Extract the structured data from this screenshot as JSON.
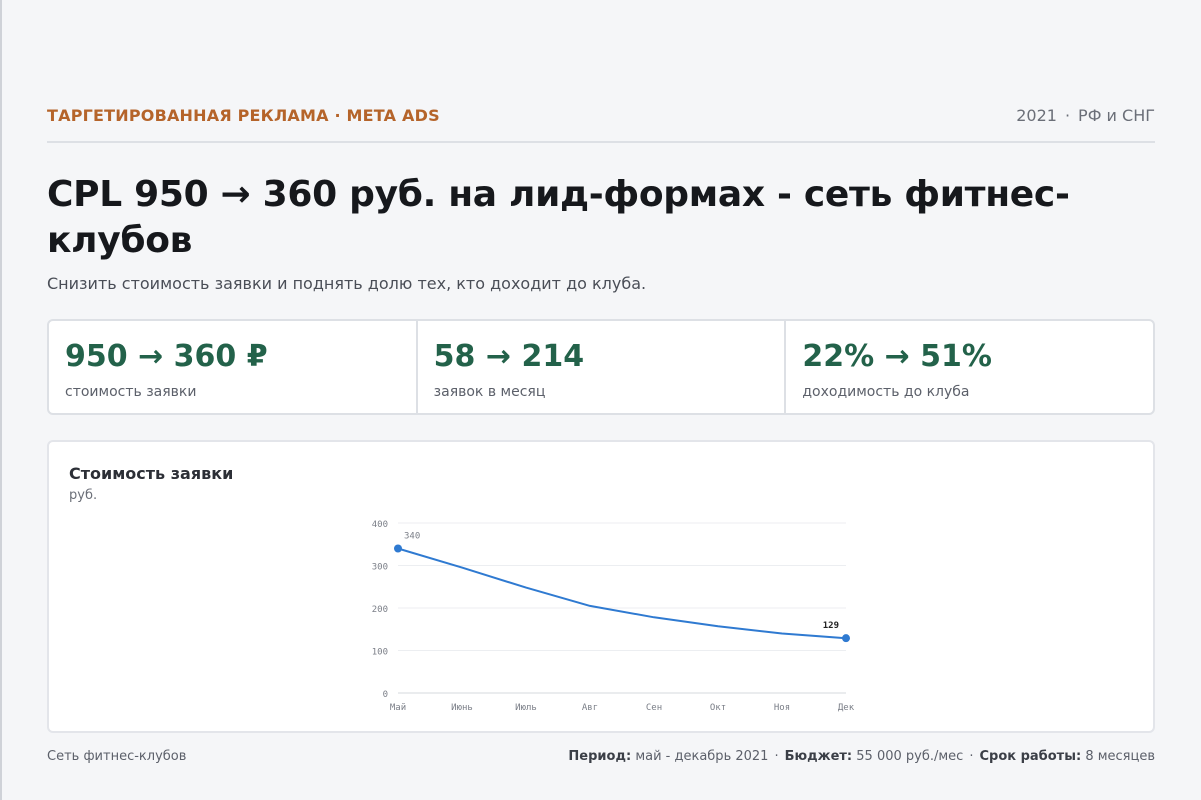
{
  "header": {
    "kicker": "ТАРГЕТИРОВАННАЯ РЕКЛАМА · META ADS",
    "year": "2021",
    "region": "РФ и СНГ"
  },
  "title": "CPL 950 → 360 руб. на лид-формах - сеть фитнес-клубов",
  "subtitle": "Снизить стоимость заявки и поднять долю тех, кто доходит до клуба.",
  "kpis": [
    {
      "value": "950 → 360 ₽",
      "label": "стоимость заявки"
    },
    {
      "value": "58 → 214",
      "label": "заявок в месяц"
    },
    {
      "value": "22% → 51%",
      "label": "доходимость до клуба"
    }
  ],
  "chart": {
    "title": "Стоимость заявки",
    "unit": "руб."
  },
  "chart_data": {
    "type": "line",
    "categories": [
      "Май",
      "Июнь",
      "Июль",
      "Авг",
      "Сен",
      "Окт",
      "Ноя",
      "Дек"
    ],
    "values": [
      340,
      295,
      248,
      205,
      178,
      157,
      140,
      129
    ],
    "ylim": [
      0,
      400
    ],
    "yticks": [
      0,
      100,
      200,
      300,
      400
    ],
    "grid": true,
    "point_labels": [
      {
        "index": 0,
        "text": "340"
      },
      {
        "index": 7,
        "text": "129"
      }
    ],
    "color": "#2f7ad1"
  },
  "footer": {
    "client": "Сеть фитнес-клубов",
    "period_label": "Период:",
    "period_value": "май - декабрь 2021",
    "budget_label": "Бюджет:",
    "budget_value": "55 000 руб./мес",
    "duration_label": "Срок работы:",
    "duration_value": "8 месяцев"
  }
}
